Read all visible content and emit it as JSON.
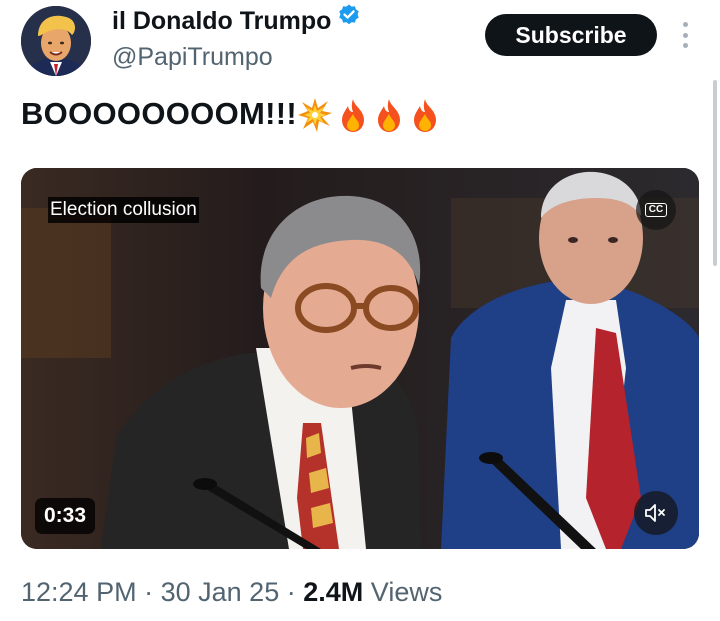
{
  "author": {
    "display_name": "il Donaldo Trumpo",
    "handle": "@PapiTrumpo",
    "verified": true,
    "avatar_icon": "cartoon-portrait-avatar"
  },
  "actions": {
    "subscribe_label": "Subscribe",
    "more_icon": "vertical-ellipsis-icon"
  },
  "tweet": {
    "text": "BOOOOOOOOM!!!",
    "emojis": [
      "collision-emoji",
      "fire-emoji",
      "fire-emoji",
      "fire-emoji"
    ]
  },
  "video": {
    "caption": "Election collusion",
    "cc_label": "CC",
    "duration": "0:33",
    "muted": true
  },
  "meta": {
    "time": "12:24 PM",
    "separator": "·",
    "date": "30 Jan 25",
    "views_count": "2.4M",
    "views_label": "Views"
  },
  "colors": {
    "text_primary": "#0f1419",
    "text_secondary": "#536471",
    "verified_blue": "#1d9bf0",
    "button_dark": "#0f1419"
  }
}
